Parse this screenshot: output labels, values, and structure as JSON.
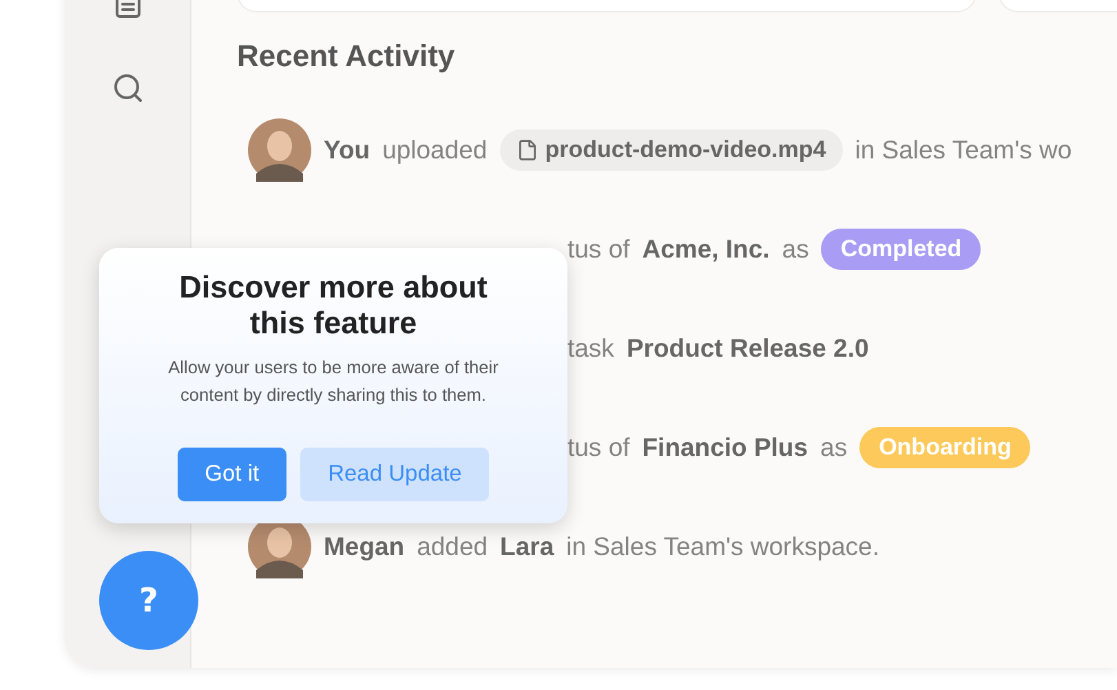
{
  "activity": {
    "title": "Recent Activity",
    "rows": [
      {
        "avatar": true,
        "hidden_lead": false,
        "parts": [
          {
            "kind": "bold",
            "text": "You"
          },
          {
            "kind": "plain",
            "text": "uploaded"
          },
          {
            "kind": "file",
            "text": "product-demo-video.mp4"
          },
          {
            "kind": "plain",
            "text": "in Sales Team's wo"
          }
        ]
      },
      {
        "avatar": false,
        "hidden_lead": true,
        "parts": [
          {
            "kind": "plain",
            "text": "tus of"
          },
          {
            "kind": "bold",
            "text": "Acme, Inc."
          },
          {
            "kind": "plain",
            "text": "as"
          },
          {
            "kind": "badge",
            "text": "Completed",
            "color": "#a99cf5"
          }
        ]
      },
      {
        "avatar": false,
        "hidden_lead": true,
        "parts": [
          {
            "kind": "plain",
            "text": "task"
          },
          {
            "kind": "bold",
            "text": "Product Release 2.0"
          }
        ]
      },
      {
        "avatar": false,
        "hidden_lead": true,
        "parts": [
          {
            "kind": "plain",
            "text": "tus of"
          },
          {
            "kind": "bold",
            "text": "Financio Plus"
          },
          {
            "kind": "plain",
            "text": "as"
          },
          {
            "kind": "badge",
            "text": "Onboarding",
            "color": "#fdc95a"
          }
        ]
      },
      {
        "avatar": true,
        "hidden_lead": false,
        "parts": [
          {
            "kind": "bold",
            "text": "Megan"
          },
          {
            "kind": "plain",
            "text": "added"
          },
          {
            "kind": "bold",
            "text": "Lara"
          },
          {
            "kind": "plain",
            "text": "in Sales Team's workspace."
          }
        ]
      }
    ]
  },
  "popup": {
    "title": "Discover more about this feature",
    "body": "Allow your users to be more aware of their content by directly sharing this to them.",
    "buttons": [
      {
        "label": "Got it",
        "kind": "primary"
      },
      {
        "label": "Read Update",
        "kind": "secondary"
      }
    ]
  },
  "help_button": {
    "label": "?"
  }
}
